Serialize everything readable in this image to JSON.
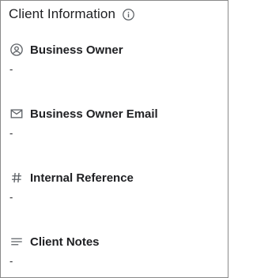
{
  "panel": {
    "title": "Client Information",
    "info_icon": "info-circle-icon"
  },
  "fields": [
    {
      "icon": "account-circle-icon",
      "label": "Business Owner",
      "value": "-"
    },
    {
      "icon": "mail-icon",
      "label": "Business Owner Email",
      "value": "-"
    },
    {
      "icon": "hash-icon",
      "label": "Internal Reference",
      "value": "-"
    },
    {
      "icon": "notes-icon",
      "label": "Client Notes",
      "value": "-"
    }
  ]
}
